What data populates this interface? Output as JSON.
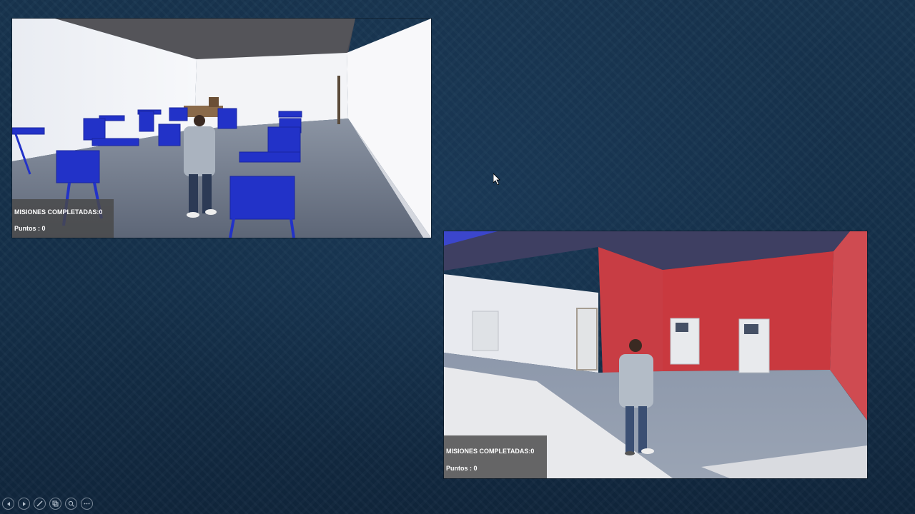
{
  "viewports": [
    {
      "scene": "classroom",
      "hud": {
        "missions_label": "MISIONES COMPLETADAS:0",
        "points_label": "Puntos : 0"
      }
    },
    {
      "scene": "atm-room",
      "hud": {
        "missions_label": "MISIONES COMPLETADAS:0",
        "points_label": "Puntos : 0"
      }
    }
  ],
  "presenter_controls": [
    "previous-icon",
    "next-icon",
    "pen-icon",
    "slides-icon",
    "zoom-icon",
    "more-icon"
  ],
  "colors": {
    "background": "#15324c",
    "chair_blue": "#2233cc",
    "wall_red": "#c9373c",
    "hud_panel": "#484848"
  }
}
